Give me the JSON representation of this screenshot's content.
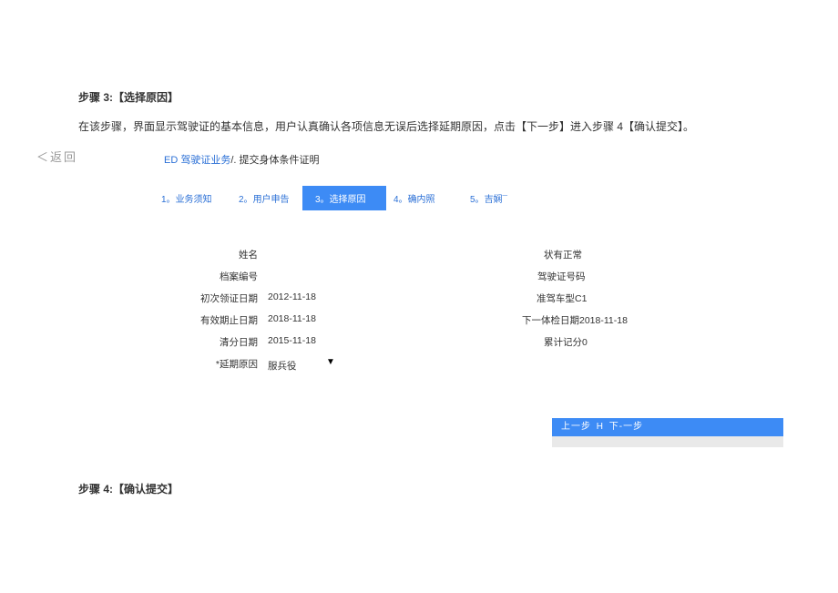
{
  "title3": "步骤 3:【选择原因】",
  "desc3": "在该步骤，界面显示驾驶证的基本信息，用户认真确认各项信息无误后选择延期原因，点击【下一步】进入步骤 4【确认提交】。",
  "back": "＜返回",
  "breadcrumb": {
    "link": "ED 驾驶证业务",
    "rest": "/. 提交身体条件证明"
  },
  "steps": [
    {
      "n": "1。",
      "t": "业务须知"
    },
    {
      "n": "2。",
      "t": "用户申告"
    },
    {
      "n": "3。",
      "t": "选择原因"
    },
    {
      "n": "4。",
      "t": "确内照"
    },
    {
      "n": "5。",
      "t": "吉娴¯"
    }
  ],
  "info": {
    "nameLabel": "姓名",
    "fileNoLabel": "档案编号",
    "firstDateLabel": "初次领证日期",
    "firstDateValue": "2012-11-18",
    "expireLabel": "有效期止日期",
    "expireValue": "2018-11-18",
    "clearLabel": "清分日期",
    "clearValue": "2015-11-18",
    "delayLabel": "*延期原因",
    "delayValue": "服兵役",
    "statusLabel": "状有正常",
    "licNoLabel": "驾驶证号码",
    "vehTypeLabel": "准驾车型",
    "vehTypeValue": "C1",
    "nextCheckLabel": "下一体检日期",
    "nextCheckValue": "2018-11-18",
    "scoreLabel": "累计记分",
    "scoreValue": "0"
  },
  "btnPrev": "上一步",
  "btnSep": "H",
  "btnNext": "下-一步",
  "title4": "步骤 4:【确认提交】"
}
